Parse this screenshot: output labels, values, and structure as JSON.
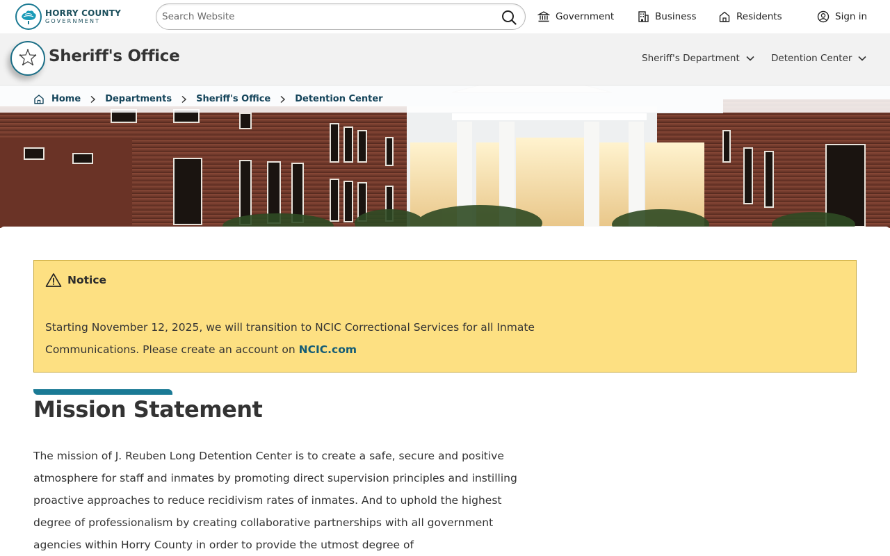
{
  "header": {
    "logo_line1": "HORRY COUNTY",
    "logo_line2": "GOVERNMENT",
    "search_placeholder": "Search Website",
    "nav": [
      {
        "label": "Government",
        "icon": "government-building-icon"
      },
      {
        "label": "Business",
        "icon": "office-building-icon"
      },
      {
        "label": "Residents",
        "icon": "house-icon"
      }
    ],
    "signin_label": "Sign in"
  },
  "department": {
    "title": "Sheriff's Office",
    "nav": [
      {
        "label": "Sheriff's Department"
      },
      {
        "label": "Detention Center"
      }
    ]
  },
  "breadcrumb": [
    {
      "label": "Home"
    },
    {
      "label": "Departments"
    },
    {
      "label": "Sheriff's Office"
    },
    {
      "label": "Detention Center"
    }
  ],
  "notice": {
    "heading": "Notice",
    "text": "Starting November 12, 2025, we will transition to NCIC Correctional Services for all Inmate Communications. Please create an account on ",
    "link_label": "NCIC.com"
  },
  "mission": {
    "title": "Mission Statement",
    "body": "The mission of J. Reuben Long Detention Center is to create a safe, secure and positive atmosphere for staff and inmates by promoting direct supervision principles and instilling proactive approaches to reduce recidivism rates of inmates. And to uphold the highest degree of professionalism by creating collaborative partnerships with all government agencies within Horry County in order to provide the utmost degree of"
  },
  "colors": {
    "brand_teal": "#1b6e86",
    "notice_bg": "#fde082",
    "link": "#145c75"
  }
}
